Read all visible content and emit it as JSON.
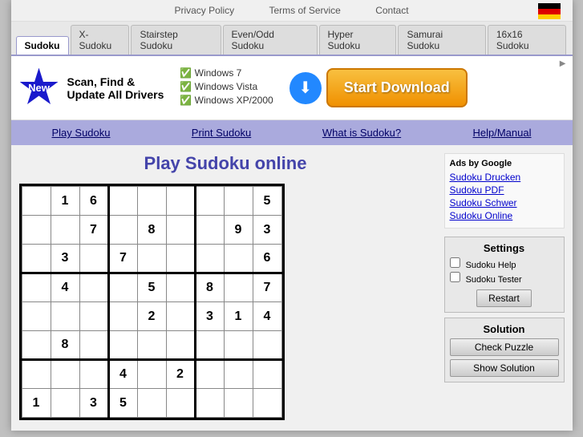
{
  "topbar": {
    "links": [
      "Privacy Policy",
      "Terms of Service",
      "Contact"
    ]
  },
  "tabs": [
    {
      "label": "Sudoku",
      "active": true
    },
    {
      "label": "X-Sudoku",
      "active": false
    },
    {
      "label": "Stairstep Sudoku",
      "active": false
    },
    {
      "label": "Even/Odd Sudoku",
      "active": false
    },
    {
      "label": "Hyper Sudoku",
      "active": false
    },
    {
      "label": "Samurai Sudoku",
      "active": false
    },
    {
      "label": "16x16 Sudoku",
      "active": false
    }
  ],
  "ad": {
    "badge": "New",
    "text": "Scan, Find &\nUpdate All Drivers",
    "features": [
      "Windows 7",
      "Windows Vista",
      "Windows XP/2000"
    ],
    "button": "Start Download",
    "label": "▶"
  },
  "nav": {
    "items": [
      "Play Sudoku",
      "Print Sudoku",
      "What is Sudoku?",
      "Help/Manual"
    ]
  },
  "main": {
    "title": "Play Sudoku online"
  },
  "ads_sidebar": {
    "title": "Ads by Google",
    "links": [
      "Sudoku Drucken",
      "Sudoku PDF",
      "Sudoku Schwer",
      "Sudoku Online"
    ]
  },
  "settings": {
    "title": "Settings",
    "help_label": "Sudoku Help",
    "tester_label": "Sudoku Tester",
    "restart_label": "Restart"
  },
  "solution": {
    "title": "Solution",
    "check_label": "Check Puzzle",
    "show_label": "Show Solution"
  },
  "sudoku": {
    "grid": [
      [
        "",
        "1",
        "6",
        "",
        "",
        "",
        "",
        "",
        "5"
      ],
      [
        "",
        "",
        "7",
        "",
        "8",
        "",
        "",
        "9",
        "3"
      ],
      [
        "",
        "3",
        "",
        "7",
        "",
        "",
        "",
        "",
        "6"
      ],
      [
        "",
        "4",
        "",
        "",
        "5",
        "",
        "8",
        "",
        "7"
      ],
      [
        "",
        "",
        "",
        "",
        "2",
        "",
        "3",
        "1",
        "4"
      ],
      [
        "",
        "8",
        "",
        "",
        "",
        "",
        "",
        "",
        ""
      ],
      [
        "",
        "",
        "",
        "4",
        "",
        "2",
        "",
        "",
        ""
      ],
      [
        "1",
        "",
        "3",
        "5",
        "",
        "",
        "",
        "",
        ""
      ]
    ]
  }
}
